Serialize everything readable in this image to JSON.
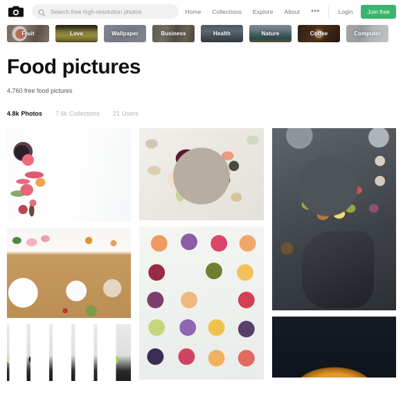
{
  "header": {
    "logo_icon": "camera-icon",
    "search": {
      "icon": "search-icon",
      "value": "",
      "placeholder": "Search free high-resolution photos"
    },
    "nav_links": [
      {
        "label": "Home"
      },
      {
        "label": "Collections"
      },
      {
        "label": "Explore"
      },
      {
        "label": "About"
      }
    ],
    "more_label": "•••",
    "login_label": "Login",
    "join_label": "Join free",
    "join_color": "#3cb46e"
  },
  "categories": [
    {
      "label": "Fruit",
      "class": "bg-fruit"
    },
    {
      "label": "Love",
      "class": "bg-love"
    },
    {
      "label": "Wallpaper",
      "class": "bg-wallpaper"
    },
    {
      "label": "Business",
      "class": "bg-business"
    },
    {
      "label": "Health",
      "class": "bg-health"
    },
    {
      "label": "Nature",
      "class": "bg-nature"
    },
    {
      "label": "Coffee",
      "class": "bg-coffee"
    },
    {
      "label": "Computer",
      "class": "bg-computer"
    }
  ],
  "page": {
    "title": "Food pictures",
    "subtitle": "4,760 free food pictures"
  },
  "stats": [
    {
      "num": "4.8k",
      "label": "Photos",
      "active": true
    },
    {
      "num": "7.6k",
      "label": "Collections",
      "active": false
    },
    {
      "num": "21",
      "label": "Users",
      "active": false
    }
  ],
  "photos": {
    "col1": [
      {
        "alt": "Strawberries, berries, rhubarb and grapefruit flat lay on white background"
      },
      {
        "alt": "Breakfast bowls with berries, granola and avocado on wooden board with tulips"
      },
      {
        "alt": "Salad bar with white square bowls of greens and vegetables"
      }
    ],
    "col2": [
      {
        "alt": "Grazing board with grapes, hummus, crackers, apple slices and olives"
      },
      {
        "alt": "Grid of mini fruit tarts topped with berries and edible flowers"
      }
    ],
    "col3": [
      {
        "alt": "Dark moody platter of figs, grapes, olives, eggs and prosciutto on slate"
      },
      {
        "alt": "Golden baked loaf on dark blue background"
      }
    ]
  }
}
